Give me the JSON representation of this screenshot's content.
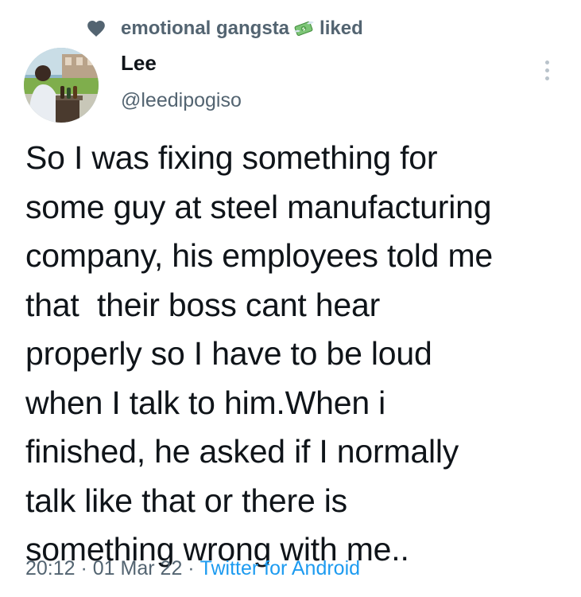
{
  "social_context": {
    "user": "emotional gangsta",
    "action": "liked",
    "icon": "heart-icon",
    "emoji_icon": "money-with-wings-icon"
  },
  "author": {
    "display_name": "Lee",
    "handle": "@leedipogiso",
    "avatar_icon": "avatar-photo"
  },
  "tweet": {
    "lines": [
      "So I was fixing something for",
      "some guy at steel manufacturing",
      "company, his employees told me",
      "that  their boss cant hear",
      "properly so I have to be loud",
      "when I talk to him.When i",
      "finished, he asked if I normally",
      "talk like that or there is",
      "something wrong with me.."
    ]
  },
  "meta": {
    "time": "20:12",
    "separator": " · ",
    "date": "01 Mar 22",
    "source": "Twitter for Android"
  },
  "colors": {
    "text": "#0f1419",
    "secondary": "#536471",
    "link": "#1d9bf0"
  }
}
